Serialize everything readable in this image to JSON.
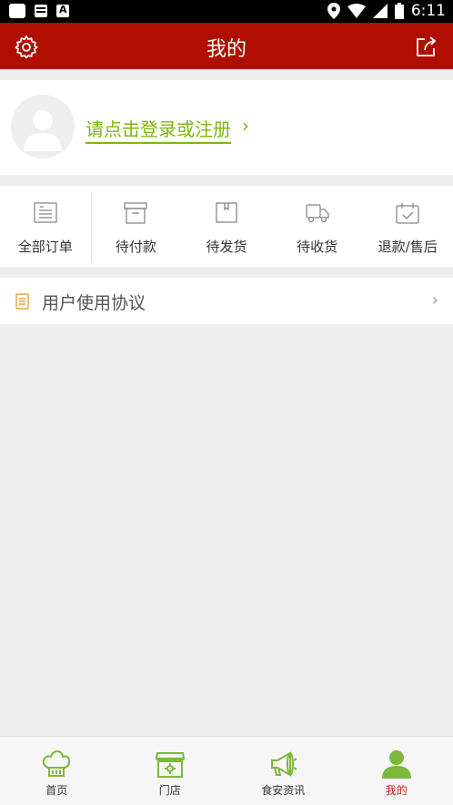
{
  "status_bar": {
    "time": "6:11"
  },
  "app_bar": {
    "title": "我的"
  },
  "profile": {
    "login_text": "请点击登录或注册",
    "arrow": "›"
  },
  "orders": [
    {
      "label": "全部订单",
      "icon": "list-icon"
    },
    {
      "label": "待付款",
      "icon": "box-icon"
    },
    {
      "label": "待发货",
      "icon": "package-icon"
    },
    {
      "label": "待收货",
      "icon": "truck-icon"
    },
    {
      "label": "退款/售后",
      "icon": "calendar-check-icon"
    }
  ],
  "menu": {
    "agreement_label": "用户使用协议",
    "arrow": "›"
  },
  "tabs": [
    {
      "label": "首页",
      "icon": "chef-hat-icon"
    },
    {
      "label": "门店",
      "icon": "store-icon"
    },
    {
      "label": "食安资讯",
      "icon": "megaphone-icon"
    },
    {
      "label": "我的",
      "icon": "person-icon",
      "active": true
    }
  ],
  "colors": {
    "primary": "#b00e00",
    "accent_green": "#7cb80a",
    "active_tab": "#d9131a"
  }
}
